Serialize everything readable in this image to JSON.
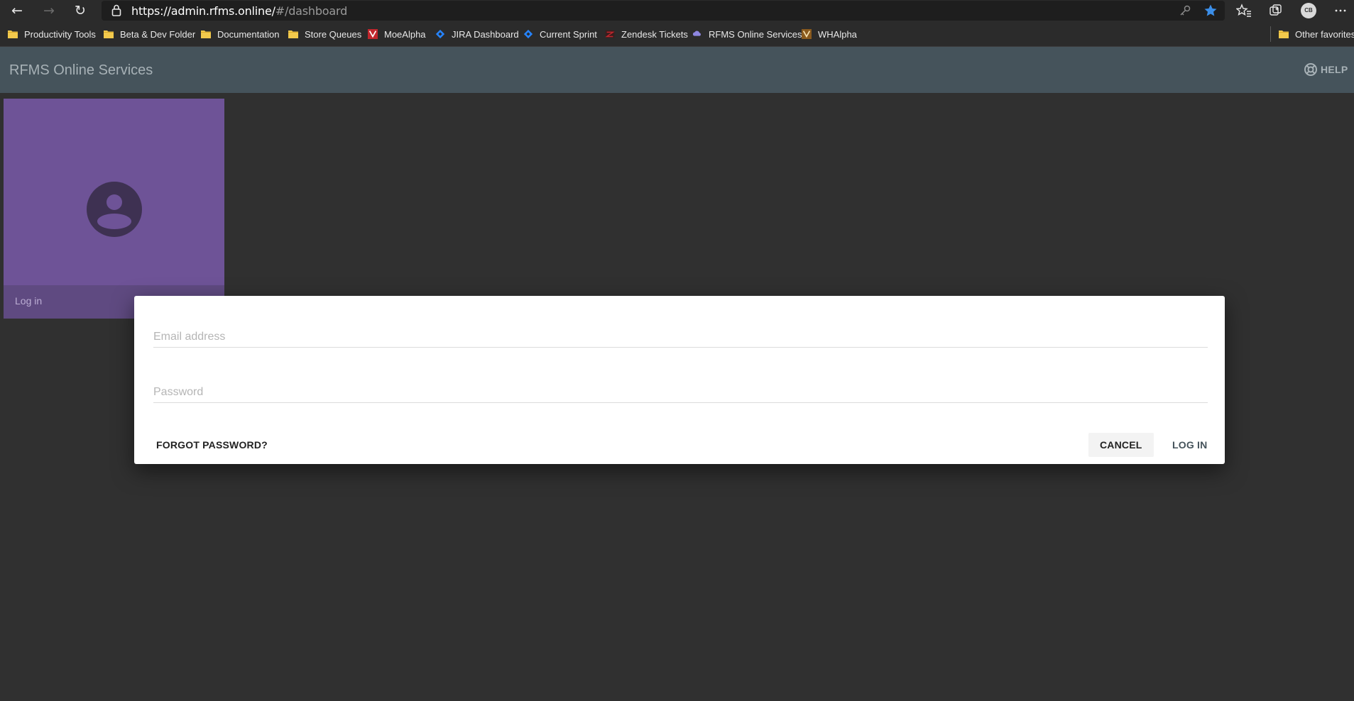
{
  "browser": {
    "url_host": "https://admin.rfms.online/",
    "url_path": "#/dashboard",
    "profile_initials": "CB",
    "bookmarks": [
      {
        "label": "Productivity Tools",
        "icon": "folder-icon"
      },
      {
        "label": "Beta & Dev Folder",
        "icon": "folder-icon"
      },
      {
        "label": "Documentation",
        "icon": "folder-icon"
      },
      {
        "label": "Store Queues",
        "icon": "folder-icon"
      },
      {
        "label": "MoeAlpha",
        "icon": "moealpha-favicon"
      },
      {
        "label": "JIRA Dashboard",
        "icon": "jira-favicon"
      },
      {
        "label": "Current Sprint",
        "icon": "jira-favicon"
      },
      {
        "label": "Zendesk Tickets",
        "icon": "zendesk-favicon"
      },
      {
        "label": "RFMS Online Services",
        "icon": "rfms-favicon"
      },
      {
        "label": "WHAlpha",
        "icon": "whalpha-favicon"
      }
    ],
    "other_favorites": "Other favorites"
  },
  "app": {
    "title": "RFMS Online Services",
    "help_label": "HELP"
  },
  "tile": {
    "label": "Log in",
    "icon": "account-circle-icon",
    "color": "#6e5397"
  },
  "dialog": {
    "email_placeholder": "Email address",
    "email_value": "",
    "password_placeholder": "Password",
    "password_value": "",
    "forgot_label": "FORGOT PASSWORD?",
    "cancel_label": "CANCEL",
    "login_label": "LOG IN"
  },
  "colors": {
    "header": "#45535b",
    "background": "#303030",
    "accent": "#45535b"
  }
}
